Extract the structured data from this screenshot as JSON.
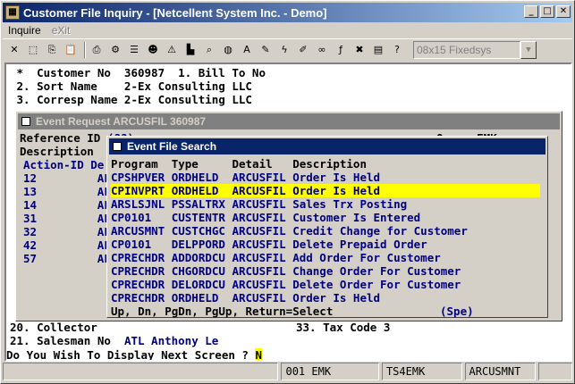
{
  "window": {
    "title": "Customer File Inquiry - [Netcellent System Inc. - Demo]",
    "app_icon": "cf"
  },
  "menu": {
    "inquire": "Inquire",
    "exit": "eXit"
  },
  "toolbar": {
    "font_select": "08x15 Fixedsys"
  },
  "screen": {
    "line1": " *  Customer No  360987  1. Bill To No",
    "line2": " 2. Sort Name    2-Ex Consulting LLC",
    "line3": " 3. Corresp Name 2-Ex Consulting LLC",
    "line_collector": "20. Collector",
    "line_taxcode": "33. Tax Code 3",
    "line_salesman_label": "21. Salesman No  ",
    "line_salesman_value": "ATL Anthony Le",
    "prompt": "Do You Wish To Display Next Screen ? ",
    "prompt_cursor": "N"
  },
  "event_request": {
    "title": "Event Request ARCUSFIL 360987",
    "ref_label": "Reference ID",
    "ref_value": "(??)",
    "desc_label": "Description",
    "owner_label": "Owner EMK",
    "header": "Action-ID De",
    "rows": [
      {
        "id": "12",
        "d": "AF"
      },
      {
        "id": "13",
        "d": "AF"
      },
      {
        "id": "14",
        "d": "AF"
      },
      {
        "id": "31",
        "d": "AF"
      },
      {
        "id": "32",
        "d": "AF"
      },
      {
        "id": "42",
        "d": "AF"
      },
      {
        "id": "57",
        "d": "AF"
      }
    ]
  },
  "event_search": {
    "title": "Event File Search",
    "header": "Program  Type     Detail   Description",
    "rows": [
      "CPSHPVER ORDHELD  ARCUSFIL Order Is Held",
      "CPINVPRT ORDHELD  ARCUSFIL Order Is Held",
      "ARSLSJNL PSSALTRX ARCUSFIL Sales Trx Posting",
      "CP0101   CUSTENTR ARCUSFIL Customer Is Entered",
      "ARCUSMNT CUSTCHGC ARCUSFIL Credit Change for Customer",
      "CP0101   DELPPORD ARCUSFIL Delete Prepaid Order",
      "CPRECHDR ADDORDCU ARCUSFIL Add Order For Customer",
      "CPRECHDR CHGORDCU ARCUSFIL Change Order For Customer",
      "CPRECHDR DELORDCU ARCUSFIL Delete Order For Customer",
      "CPRECHDR ORDHELD  ARCUSFIL Order Is Held"
    ],
    "selected_index": 1,
    "footer": "Up, Dn, PgDn, PgUp, Return=Select",
    "footer_right": "(Spe)"
  },
  "status": {
    "c1": "",
    "c2": "001 EMK",
    "c3": "TS4EMK",
    "c4": "ARCUSMNT",
    "c5": ""
  },
  "colors": {
    "highlight": "#ffff00",
    "terminal_text": "#000080",
    "title_active": "#0a246a"
  }
}
